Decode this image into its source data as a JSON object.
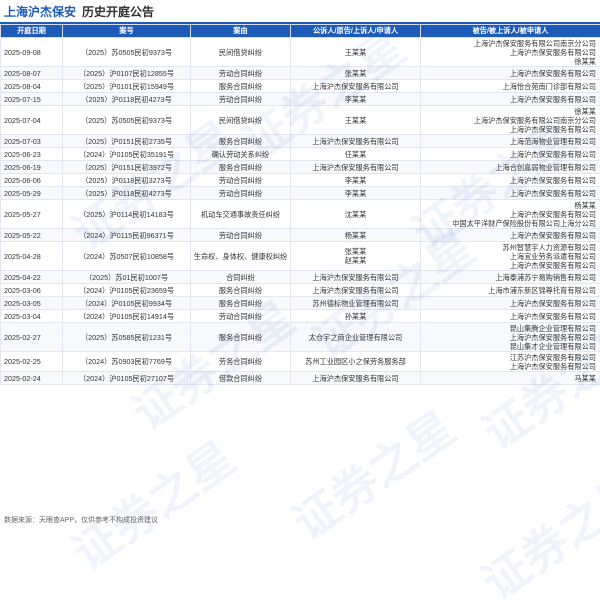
{
  "header": {
    "company": "上海沪杰保安",
    "subtitle": "历史开庭公告"
  },
  "columns": [
    "开庭日期",
    "案号",
    "案由",
    "公诉人/原告/上诉人/申请人",
    "被告/被上诉人/被申请人"
  ],
  "rows": [
    {
      "date": "2025-09-08",
      "case_no": "（2025）苏0505民初9373号",
      "cause": "民间借贷纠纷",
      "plaintiff": "王某某",
      "defendant": [
        "上海沪杰保安服务有限公司南京分公司",
        "上海沪杰保安服务有限公司",
        "徐某某"
      ]
    },
    {
      "date": "2025-08-07",
      "case_no": "（2025）沪0107民初12855号",
      "cause": "劳动合同纠纷",
      "plaintiff": "张某某",
      "defendant": [
        "上海沪杰保安服务有限公司"
      ]
    },
    {
      "date": "2025-08-04",
      "case_no": "（2025）沪0101民初15949号",
      "cause": "服务合同纠纷",
      "plaintiff": "上海沪杰保安服务有限公司",
      "defendant": [
        "上海怡合苑南门诊部有限公司"
      ]
    },
    {
      "date": "2025-07-15",
      "case_no": "（2025）沪0118民初4273号",
      "cause": "劳动合同纠纷",
      "plaintiff": "李某某",
      "defendant": [
        "上海沪杰保安服务有限公司"
      ]
    },
    {
      "date": "2025-07-04",
      "case_no": "（2025）苏0505民初9373号",
      "cause": "民间借贷纠纷",
      "plaintiff": "王某某",
      "defendant": [
        "徐某某",
        "上海沪杰保安服务有限公司南京分公司",
        "上海沪杰保安服务有限公司"
      ]
    },
    {
      "date": "2025-07-03",
      "case_no": "（2025）沪0151民初2735号",
      "cause": "服务合同纠纷",
      "plaintiff": "上海沪杰保安服务有限公司",
      "defendant": [
        "上海范海物业管理有限公司"
      ]
    },
    {
      "date": "2025-06-23",
      "case_no": "（2024）沪0105民初35191号",
      "cause": "确认劳动关系纠纷",
      "plaintiff": "任某某",
      "defendant": [
        "上海沪杰保安服务有限公司"
      ]
    },
    {
      "date": "2025-06-19",
      "case_no": "（2025）沪0151民初3972号",
      "cause": "服务合同纠纷",
      "plaintiff": "上海沪杰保安服务有限公司",
      "defendant": [
        "上海合创嘉弱物业管理有限公司"
      ]
    },
    {
      "date": "2025-06-06",
      "case_no": "（2025）沪0118民初3273号",
      "cause": "劳动合同纠纷",
      "plaintiff": "李某某",
      "defendant": [
        "上海沪杰保安服务有限公司"
      ]
    },
    {
      "date": "2025-05-29",
      "case_no": "（2025）沪0118民初4273号",
      "cause": "劳动合同纠纷",
      "plaintiff": "李某某",
      "defendant": [
        "上海沪杰保安服务有限公司"
      ]
    },
    {
      "date": "2025-05-27",
      "case_no": "（2025）沪0114民初14183号",
      "cause": "机动车交通事故责任纠纷",
      "plaintiff": "沈某某",
      "defendant": [
        "杨某某",
        "上海沪杰保安服务有限公司",
        "中国太平洋财产保险股份有限公司上海分公司"
      ]
    },
    {
      "date": "2025-05-22",
      "case_no": "（2024）沪0115民初96371号",
      "cause": "劳动合同纠纷",
      "plaintiff": "杨某某",
      "defendant": [
        "上海沪杰保安服务有限公司"
      ]
    },
    {
      "date": "2025-04-28",
      "case_no": "（2024）苏0507民初10858号",
      "cause": "生命权、身体权、健康权纠纷",
      "plaintiff": "张某某\n赵某某",
      "defendant": [
        "苏州智慧宇人力资源有限公司",
        "上海宜业劳务派遣有限公司",
        "上海沪杰保安服务有限公司"
      ]
    },
    {
      "date": "2025-04-22",
      "case_no": "（2025）苏01民初1007号",
      "cause": "合同纠纷",
      "plaintiff": "上海沪杰保安服务有限公司",
      "defendant": [
        "上海泰浦苏宁易购销售有限公司"
      ]
    },
    {
      "date": "2025-03-06",
      "case_no": "（2024）沪0105民初23659号",
      "cause": "服务合同纠纷",
      "plaintiff": "上海沪杰保安服务有限公司",
      "defendant": [
        "上海市浦东新区锦尊托育有限公司"
      ]
    },
    {
      "date": "2025-03-05",
      "case_no": "（2024）沪0105民初9934号",
      "cause": "服务合同纠纷",
      "plaintiff": "苏州德标物业管理有限公司",
      "defendant": [
        "上海沪杰保安服务有限公司"
      ]
    },
    {
      "date": "2025-03-04",
      "case_no": "（2024）沪0105民初14914号",
      "cause": "劳动合同纠纷",
      "plaintiff": "孙某某",
      "defendant": [
        "上海沪杰保安服务有限公司"
      ]
    },
    {
      "date": "2025-02-27",
      "case_no": "（2025）苏0585民初1231号",
      "cause": "服务合同纠纷",
      "plaintiff": "太仓宇之商企业管理有限公司",
      "defendant": [
        "昆山集腾企业管理有限公司",
        "上海沪杰保安服务有限公司",
        "昆山集才企业管理有限公司"
      ]
    },
    {
      "date": "2025-02-25",
      "case_no": "（2024）苏0903民初7769号",
      "cause": "劳务合同纠纷",
      "plaintiff": "苏州工业园区小之保劳务服务部",
      "defendant": [
        "江苏沪杰保安服务有限公司",
        "上海沪杰保安服务有限公司"
      ]
    },
    {
      "date": "2025-02-24",
      "case_no": "（2024）沪0105民初27107号",
      "cause": "借款合同纠纷",
      "plaintiff": "上海沪杰保安服务有限公司",
      "defendant": [
        "马某某"
      ]
    }
  ],
  "footer": "数据来源：天眼查APP，仅供参考不构成投资建议",
  "watermark_text": "证券之星",
  "colors": {
    "accent": "#1e5bb8",
    "header_bg": "#1e5bb8"
  }
}
